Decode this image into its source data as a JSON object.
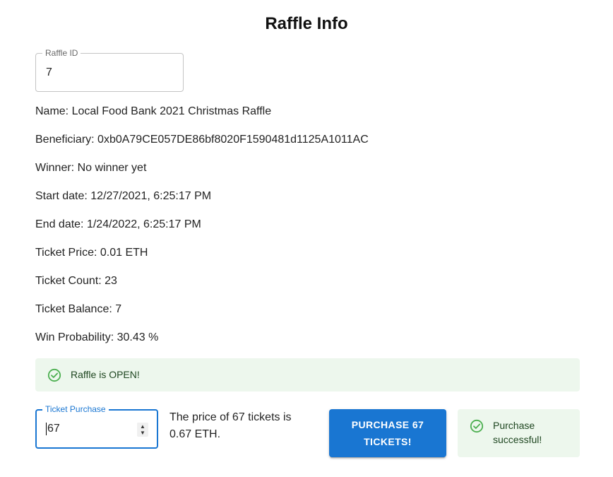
{
  "page": {
    "title": "Raffle Info"
  },
  "raffle_id_field": {
    "label": "Raffle ID",
    "value": "7"
  },
  "info": {
    "name": "Name: Local Food Bank 2021 Christmas Raffle",
    "beneficiary": "Beneficiary: 0xb0A79CE057DE86bf8020F1590481d1125A1011AC",
    "winner": "Winner: No winner yet",
    "start_date": "Start date: 12/27/2021, 6:25:17 PM",
    "end_date": "End date: 1/24/2022, 6:25:17 PM",
    "ticket_price": "Ticket Price: 0.01 ETH",
    "ticket_count": "Ticket Count: 23",
    "ticket_balance": "Ticket Balance: 7",
    "win_probability": "Win Probability: 30.43 %"
  },
  "status_alert": {
    "text": "Raffle is OPEN!",
    "icon": "check-circle-outline-icon"
  },
  "ticket_purchase": {
    "label": "Ticket Purchase",
    "value": "67",
    "price_note": "The price of 67 tickets is 0.67 ETH.",
    "button_label": "PURCHASE 67 TICKETS!"
  },
  "success_alert": {
    "text": "Purchase successful!",
    "icon": "check-circle-outline-icon"
  },
  "colors": {
    "primary": "#1976d2",
    "success_bg": "#edf7ed",
    "success_text": "#1e4620",
    "success_icon": "#4caf50"
  }
}
